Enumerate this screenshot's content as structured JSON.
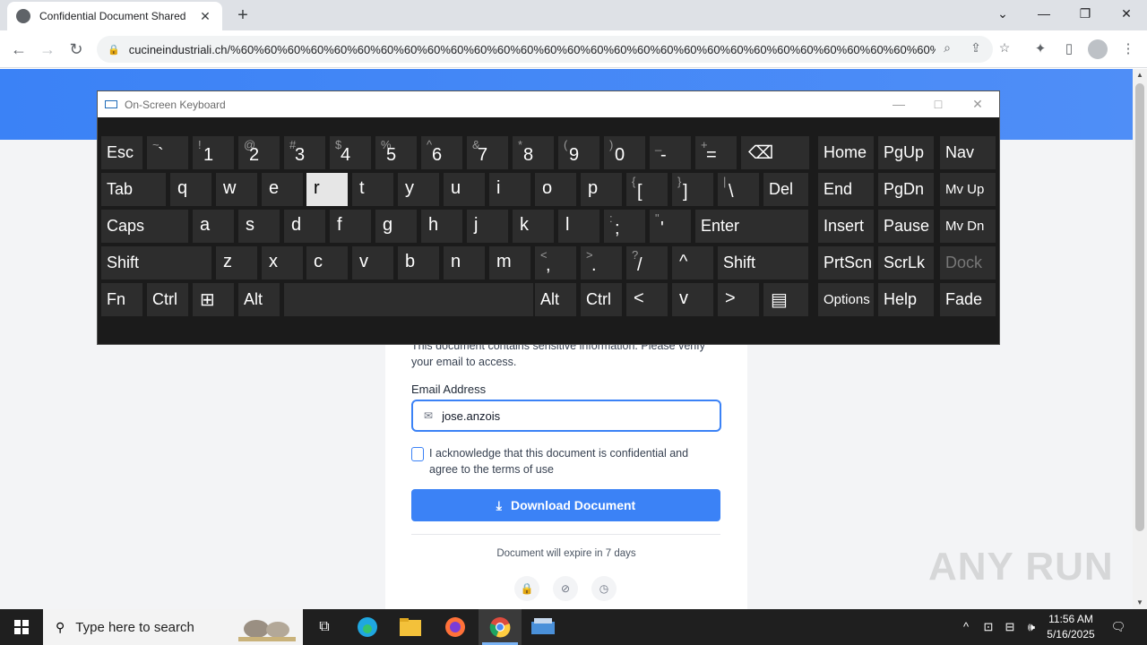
{
  "browser": {
    "tab_title": "Confidential Document Shared",
    "url": "cucineindustriali.ch/%60%60%60%60%60%60%60%60%60%60%60%60%60%60%60%60%60%60%60%60%60%60%60%60%60%60%60%60%60%60%60%60%60%..."
  },
  "card": {
    "description": "This document contains sensitive information. Please verify your email to access.",
    "email_label": "Email Address",
    "email_value": "jose.anzois",
    "ack_text": "I acknowledge that this document is confidential and agree to the terms of use",
    "download_label": "Download Document",
    "expire_text": "Document will expire in 7 days"
  },
  "watermark": "ANY RUN",
  "osk": {
    "title": "On-Screen Keyboard",
    "pressed_key": "r",
    "rows": [
      [
        "Esc",
        "~ `",
        "! 1",
        "@ 2",
        "# 3",
        "$ 4",
        "% 5",
        "^ 6",
        "& 7",
        "* 8",
        "( 9",
        ") 0",
        "_ -",
        "+ =",
        "⌫",
        "Home",
        "PgUp",
        "Nav"
      ],
      [
        "Tab",
        "q",
        "w",
        "e",
        "r",
        "t",
        "y",
        "u",
        "i",
        "o",
        "p",
        "{ [",
        "} ]",
        "| \\",
        "Del",
        "End",
        "PgDn",
        "Mv Up"
      ],
      [
        "Caps",
        "a",
        "s",
        "d",
        "f",
        "g",
        "h",
        "j",
        "k",
        "l",
        ": ;",
        "\" '",
        "Enter",
        "Insert",
        "Pause",
        "Mv Dn"
      ],
      [
        "Shift",
        "z",
        "x",
        "c",
        "v",
        "b",
        "n",
        "m",
        "< ,",
        "> .",
        "? /",
        "^",
        "Shift",
        "PrtScn",
        "ScrLk",
        "Dock"
      ],
      [
        "Fn",
        "Ctrl",
        "⊞",
        "Alt",
        "",
        "Alt",
        "Ctrl",
        "<",
        "v",
        ">",
        "▤",
        "Options",
        "Help",
        "Fade"
      ]
    ]
  },
  "taskbar": {
    "search_placeholder": "Type here to search",
    "time": "11:56 AM",
    "date": "5/16/2025"
  }
}
